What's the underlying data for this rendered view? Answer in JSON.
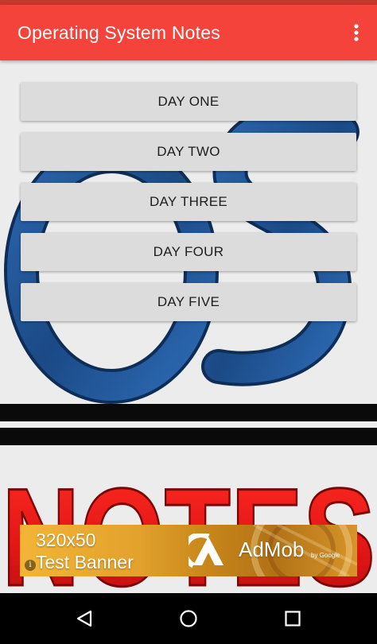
{
  "app": {
    "title": "Operating System Notes"
  },
  "menu": {
    "overflow_icon": "more-vert-icon"
  },
  "days": [
    {
      "label": "DAY ONE"
    },
    {
      "label": "DAY TWO"
    },
    {
      "label": "DAY THREE"
    },
    {
      "label": "DAY FOUR"
    },
    {
      "label": "DAY FIVE"
    }
  ],
  "background": {
    "letters_top": "OS",
    "letters_bottom": "NOTES",
    "os_color": "#1f4f8c",
    "notes_color": "#e31b1b"
  },
  "ad": {
    "size_text": "320x50",
    "test_text": "Test Banner",
    "brand": "AdMob",
    "by": "by Google",
    "info_icon": "info-icon"
  },
  "navigation": {
    "back_icon": "back-icon",
    "home_icon": "home-icon",
    "recents_icon": "recents-icon"
  },
  "colors": {
    "accent": "#f4433a",
    "button": "#dcdcdc"
  }
}
